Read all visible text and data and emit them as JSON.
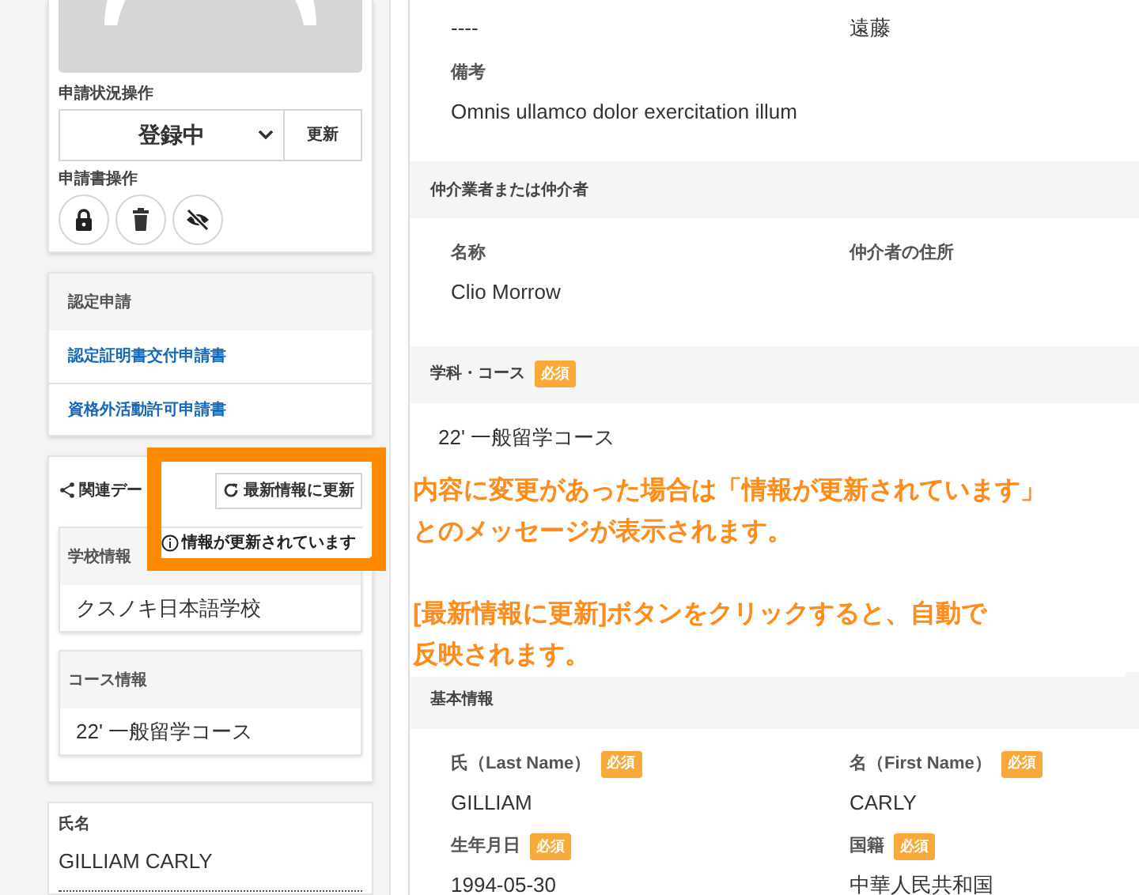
{
  "sidebar": {
    "status_label": "申請状況操作",
    "status_select": {
      "value": "登録中"
    },
    "update_button": "更新",
    "document_label": "申請書操作",
    "document_actions": [
      {
        "kind": "lock"
      },
      {
        "kind": "delete"
      },
      {
        "kind": "hide"
      }
    ],
    "certification": {
      "title": "認定申請",
      "links": [
        "認定証明書交付申請書",
        "資格外活動許可申請書"
      ]
    },
    "related": {
      "title": "関連デー",
      "refresh_button": "最新情報に更新",
      "panels": [
        {
          "title": "学校情報",
          "value": "クスノキ日本語学校"
        },
        {
          "title": "コース情報",
          "value": "22' 一般留学コース"
        }
      ]
    },
    "name": {
      "label": "氏名",
      "value": "GILLIAM CARLY"
    }
  },
  "main": {
    "sections": [
      {
        "fields": [
          {
            "value": "----"
          },
          {
            "value": "遠藤"
          },
          {
            "label": "備考",
            "value": "Omnis ullamco dolor exercitation illum"
          }
        ]
      },
      {
        "title": "仲介業者または仲介者",
        "fields": [
          {
            "label": "名称",
            "value": "Clio Morrow"
          },
          {
            "label": "仲介者の住所"
          }
        ]
      },
      {
        "title": "学科・コース",
        "badge": "必須",
        "fields": [
          {
            "value": "22' 一般留学コース"
          }
        ]
      },
      {
        "title": "基本情報",
        "fields": [
          {
            "label": "氏（Last Name）",
            "badge": "必須",
            "value": "GILLIAM"
          },
          {
            "label": "名（First Name）",
            "badge": "必須",
            "value": "CARLY"
          },
          {
            "label": "生年月日",
            "badge": "必須",
            "value": "1994-05-30"
          },
          {
            "label": "国籍",
            "badge": "必須",
            "value": "中華人民共和国"
          }
        ]
      }
    ]
  },
  "annotation": {
    "notice": "情報が更新されています",
    "paragraphs": [
      [
        "内容に変更があった場合は「情報が更新されています」",
        "とのメッセージが表示されます。"
      ],
      [
        "[最新情報に更新]ボタンをクリックすると、自動で",
        "反映されます。"
      ]
    ]
  }
}
